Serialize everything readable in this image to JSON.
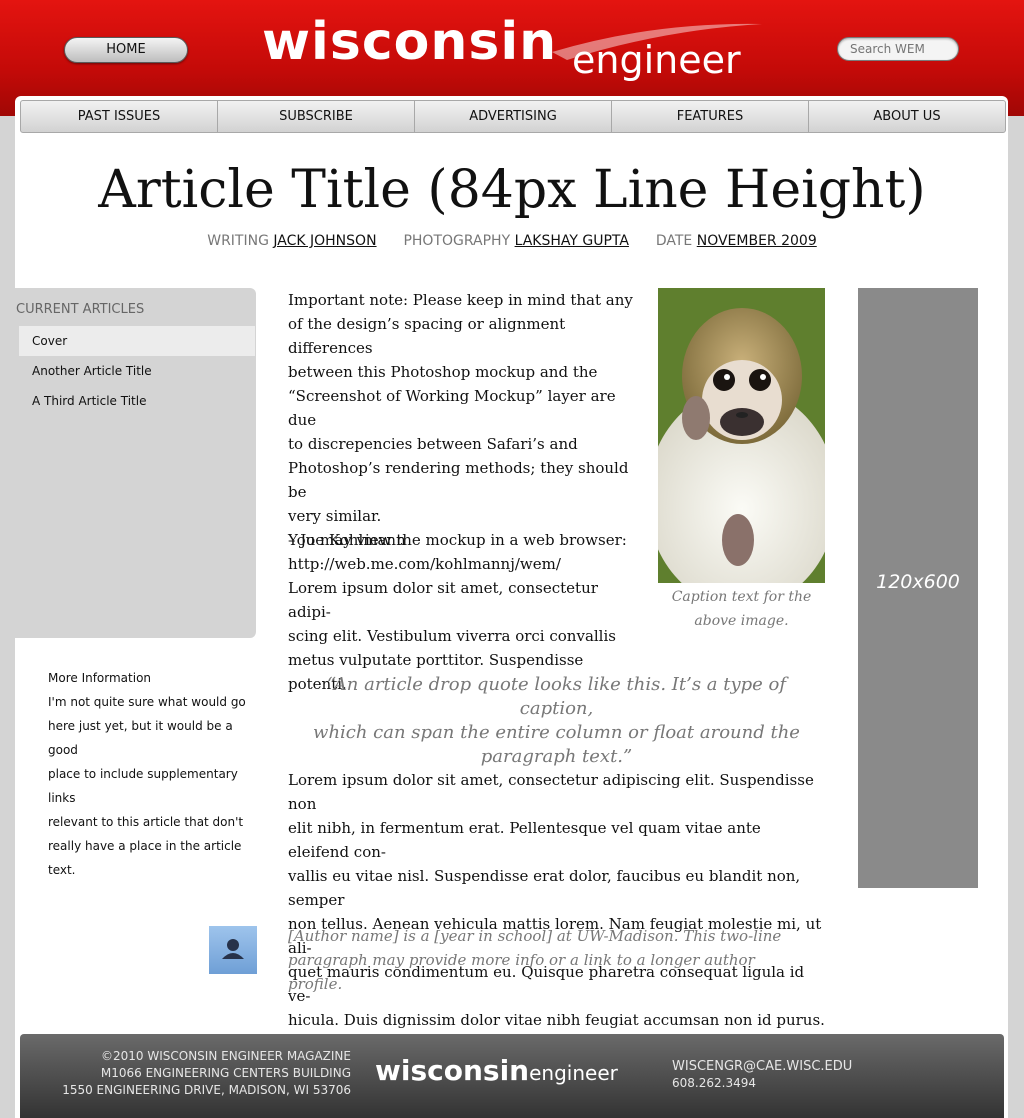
{
  "header": {
    "home_label": "HOME",
    "logo_word1": "wisconsin",
    "logo_word2": "engineer",
    "search_placeholder": "Search WEM"
  },
  "nav": [
    "PAST ISSUES",
    "SUBSCRIBE",
    "ADVERTISING",
    "FEATURES",
    "ABOUT US"
  ],
  "article": {
    "title": "Article Title (84px Line Height)",
    "byline": {
      "writing_label": "WRITING",
      "writer": "JACK JOHNSON",
      "photography_label": "PHOTOGRAPHY",
      "photographer": "LAKSHAY GUPTA",
      "date_label": "DATE",
      "date": "NOVEMBER 2009"
    },
    "note_lines": [
      "Important note:  Please keep in mind that any",
      "of the design’s spacing or alignment differences",
      "between this Photoshop mockup and the",
      "“Screenshot of Working Mockup” layer are due",
      "to discrepencies between Safari’s and",
      "Photoshop’s rendering methods; they should be",
      "very similar.",
      "You may view the mockup in a web browser:",
      "http://web.me.com/kohlmannj/wem/"
    ],
    "signature": "– Joe Kohlmann",
    "lorem1_lines": [
      "Lorem ipsum dolor sit amet, consectetur adipi-",
      "scing elit. Vestibulum viverra orci convallis",
      "metus vulputate porttitor. Suspendisse potenti."
    ],
    "caption_lines": [
      "Caption text for the",
      "above image."
    ],
    "drop_quote_lines": [
      "“An article drop quote looks like this.  It’s a type of caption,",
      "which can span the entire column or float around the",
      "paragraph text.”"
    ],
    "lorem2_lines": [
      "Lorem ipsum dolor sit amet, consectetur adipiscing elit. Suspendisse non",
      "elit nibh, in fermentum erat. Pellentesque vel quam vitae ante eleifend con-",
      "vallis eu vitae nisl. Suspendisse erat dolor, faucibus eu blandit non, semper",
      "non tellus. Aenean vehicula mattis lorem. Nam feugiat molestie mi, ut ali-",
      "quet mauris condimentum eu. Quisque pharetra consequat ligula id ve-",
      "hicula. Duis dignissim dolor vitae nibh feugiat accumsan non id purus."
    ],
    "author_bio_lines": [
      "[Author name] is a [year in school] at UW-Madison.  This two-line",
      "paragraph may provide more info or a link to a longer author profile."
    ]
  },
  "sidebar": {
    "heading": "CURRENT ARTICLES",
    "items": [
      "Cover",
      "Another Article Title",
      "A Third Article Title"
    ],
    "active_index": 0
  },
  "more_info": {
    "heading": "More Information",
    "lines": [
      "I'm not quite sure what would go",
      "here just yet, but it would be a good",
      "place to include supplementary links",
      "relevant to this article that don't",
      "really have a place in the article text."
    ]
  },
  "ad": {
    "label": "120x600"
  },
  "footer": {
    "address_lines": [
      "©2010 WISCONSIN ENGINEER MAGAZINE",
      "M1066 ENGINEERING CENTERS BUILDING",
      "1550 ENGINEERING DRIVE, MADISON, WI 53706"
    ],
    "email": "WISCENGR@CAE.WISC.EDU",
    "phone": "608.262.3494"
  },
  "colors": {
    "brand_red": "#d40e0b",
    "panel_white": "#ffffff",
    "sidebar_gray": "#d4d4d4",
    "ad_gray": "#8a8a8a",
    "muted_text": "#777777"
  },
  "icons": {
    "author": "user-silhouette-icon",
    "photo": "monkey-photo"
  }
}
